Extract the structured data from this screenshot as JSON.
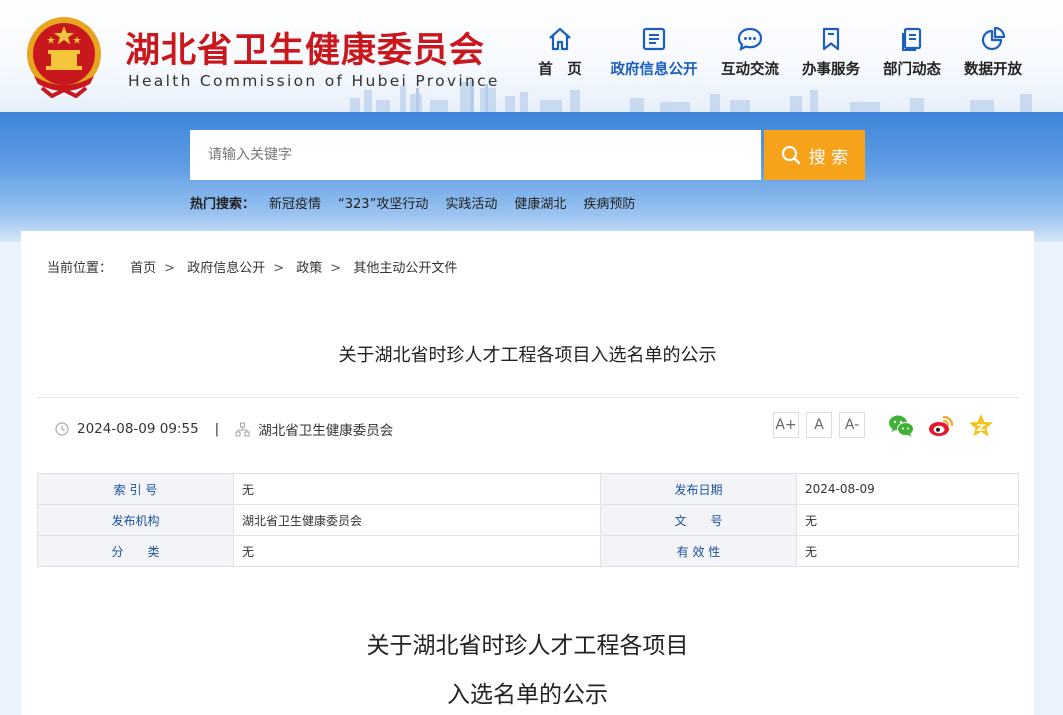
{
  "header": {
    "title": "湖北省卫生健康委员会",
    "subtitle": "Health Commission of Hubei Province",
    "brand_red": "#c8171d",
    "nav": [
      {
        "label": "首　页",
        "icon": "home-icon",
        "active": false
      },
      {
        "label": "政府信息公开",
        "icon": "document-list-icon",
        "active": true
      },
      {
        "label": "互动交流",
        "icon": "chat-bubble-icon",
        "active": false
      },
      {
        "label": "办事服务",
        "icon": "bookmark-icon",
        "active": false
      },
      {
        "label": "部门动态",
        "icon": "news-copy-icon",
        "active": false
      },
      {
        "label": "数据开放",
        "icon": "pie-chart-icon",
        "active": false
      }
    ]
  },
  "search": {
    "placeholder": "请输入关键字",
    "button_label": "搜 索",
    "hot_label": "热门搜索：",
    "hot_items": [
      "新冠疫情",
      "“323”攻坚行动",
      "实践活动",
      "健康湖北",
      "疾病预防"
    ]
  },
  "breadcrumb": {
    "label": "当前位置：",
    "items": [
      "首页",
      "政府信息公开",
      "政策",
      "其他主动公开文件"
    ]
  },
  "article": {
    "title": "关于湖北省时珍人才工程各项目入选名单的公示",
    "datetime": "2024-08-09 09:55",
    "publisher": "湖北省卫生健康委员会",
    "font_buttons": [
      "A+",
      "A",
      "A-"
    ],
    "share_icons": [
      "wechat-icon",
      "weibo-icon",
      "favorite-star-icon"
    ],
    "body_title_line1": "关于湖北省时珍人才工程各项目",
    "body_title_line2": "入选名单的公示"
  },
  "info_table": {
    "rows": [
      {
        "k1": "索 引 号",
        "v1": "无",
        "k2": "发布日期",
        "v2": "2024-08-09"
      },
      {
        "k1": "发布机构",
        "v1": "湖北省卫生健康委员会",
        "k2": "文　　号",
        "v2": "无"
      },
      {
        "k1": "分　　类",
        "v1": "无",
        "k2": "有 效 性",
        "v2": "无"
      }
    ]
  }
}
